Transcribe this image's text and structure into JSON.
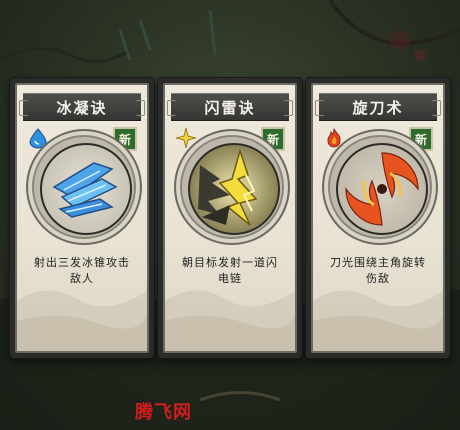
{
  "cards": [
    {
      "title": "冰凝诀",
      "badge": "新",
      "description": "射出三发冰锥攻击敌人",
      "element_icon": "water-drop-icon",
      "accent": "#3a8fd6"
    },
    {
      "title": "闪雷诀",
      "badge": "新",
      "description": "朝目标发射一道闪电链",
      "element_icon": "spark-star-icon",
      "accent": "#e1c32a"
    },
    {
      "title": "旋刀术",
      "badge": "新",
      "description": "刀光围绕主角旋转伤敌",
      "element_icon": "flame-icon",
      "accent": "#e0482a"
    }
  ],
  "watermark": "腾飞网"
}
